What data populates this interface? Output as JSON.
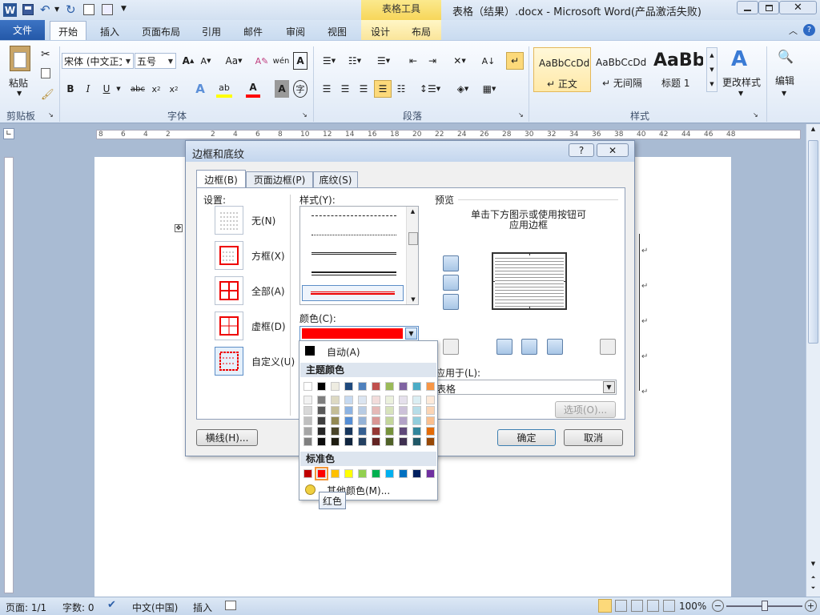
{
  "app": {
    "title": "表格（结果）.docx  -  Microsoft Word(产品激活失败)",
    "context_tab_group": "表格工具"
  },
  "ribbon_tabs": [
    "文件",
    "开始",
    "插入",
    "页面布局",
    "引用",
    "邮件",
    "审阅",
    "视图",
    "设计",
    "布局"
  ],
  "clipboard": {
    "paste_label": "粘贴",
    "group_label": "剪贴板"
  },
  "font": {
    "name": "宋体 (中文正文",
    "size": "五号",
    "group_label": "字体"
  },
  "paragraph": {
    "group_label": "段落"
  },
  "styles": {
    "group_label": "样式",
    "items": [
      {
        "preview": "AaBbCcDd",
        "name": "↵ 正文"
      },
      {
        "preview": "AaBbCcDd",
        "name": "↵ 无间隔"
      },
      {
        "preview": "AaBb",
        "name": "标题 1"
      }
    ],
    "change_styles": "更改样式"
  },
  "editing": {
    "label": "编辑"
  },
  "ruler": {
    "numbers": [
      "8",
      "6",
      "4",
      "2",
      "",
      "2",
      "4",
      "6",
      "8",
      "10",
      "12",
      "14",
      "16",
      "18",
      "20",
      "22",
      "24",
      "26",
      "28",
      "30",
      "32",
      "34",
      "36",
      "38",
      "40",
      "42",
      "44",
      "46",
      "48"
    ]
  },
  "dialog": {
    "title": "边框和底纹",
    "help": "?",
    "tabs": [
      "边框(B)",
      "页面边框(P)",
      "底纹(S)"
    ],
    "settings_label": "设置:",
    "settings": [
      "无(N)",
      "方框(X)",
      "全部(A)",
      "虚框(D)",
      "自定义(U)"
    ],
    "style_label": "样式(Y):",
    "color_label": "颜色(C):",
    "preview_label": "预览",
    "preview_hint_1": "单击下方图示或使用按钮可",
    "preview_hint_2": "应用边框",
    "apply_to_label": "应用于(L):",
    "apply_to_value": "表格",
    "options_button": "选项(O)...",
    "horizontal_line_button": "横线(H)...",
    "ok_button": "确定",
    "cancel_button": "取消"
  },
  "color_popup": {
    "auto_label": "自动(A)",
    "theme_label": "主题颜色",
    "standard_label": "标准色",
    "more_label": "其他颜色(M)...",
    "tooltip": "红色",
    "selected_color": "#ff0000",
    "theme_top": [
      "#ffffff",
      "#000000",
      "#eeece1",
      "#1f497d",
      "#4f81bd",
      "#c0504d",
      "#9bbb59",
      "#8064a2",
      "#4bacc6",
      "#f79646"
    ],
    "theme_shades": [
      [
        "#f2f2f2",
        "#7f7f7f",
        "#ddd9c3",
        "#c6d9f0",
        "#dbe5f1",
        "#f2dcdb",
        "#ebf1dd",
        "#e5e0ec",
        "#dbeef3",
        "#fdeada"
      ],
      [
        "#d8d8d8",
        "#595959",
        "#c4bd97",
        "#8db3e2",
        "#b8cce4",
        "#e5b9b7",
        "#d7e3bc",
        "#ccc1d9",
        "#b7dde8",
        "#fbd5b5"
      ],
      [
        "#bfbfbf",
        "#3f3f3f",
        "#938953",
        "#548dd4",
        "#95b3d7",
        "#d99694",
        "#c3d69b",
        "#b2a2c7",
        "#92cddc",
        "#fac08f"
      ],
      [
        "#a5a5a5",
        "#262626",
        "#494429",
        "#17365d",
        "#366092",
        "#953734",
        "#76923c",
        "#5f497a",
        "#31859b",
        "#e36c09"
      ],
      [
        "#7f7f7f",
        "#0c0c0c",
        "#1d1b10",
        "#0f243e",
        "#244061",
        "#632423",
        "#4f6128",
        "#3f3151",
        "#205867",
        "#974806"
      ]
    ],
    "standard": [
      "#c00000",
      "#ff0000",
      "#ffc000",
      "#ffff00",
      "#92d050",
      "#00b050",
      "#00b0f0",
      "#0070c0",
      "#002060",
      "#7030a0"
    ]
  },
  "status": {
    "page": "页面: 1/1",
    "words": "字数: 0",
    "lang": "中文(中国)",
    "mode": "插入",
    "zoom": "100%"
  }
}
